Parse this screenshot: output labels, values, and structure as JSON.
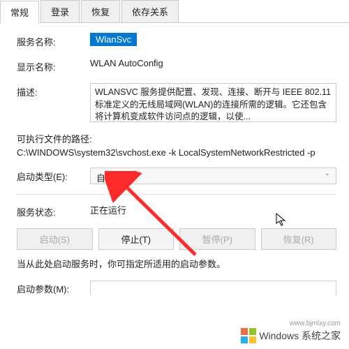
{
  "tabs": [
    "常规",
    "登录",
    "恢复",
    "依存关系"
  ],
  "activeTab": 0,
  "fields": {
    "serviceNameLabel": "服务名称:",
    "serviceName": "WlanSvc",
    "displayNameLabel": "显示名称:",
    "displayName": "WLAN AutoConfig",
    "descLabel": "描述:",
    "description": "WLANSVC 服务提供配置、发现、连接、断开与 IEEE 802.11 标准定义的无线局域网(WLAN)的连接所需的逻辑。它还包含将计算机变成软件访问点的逻辑，以使...",
    "exePathLabel": "可执行文件的路径:",
    "exePath": "C:\\WINDOWS\\system32\\svchost.exe -k LocalSystemNetworkRestricted -p",
    "startupTypeLabel": "启动类型(E):",
    "startupType": "自动",
    "statusLabel": "服务状态:",
    "status": "正在运行",
    "hint": "当从此处启动服务时，你可指定所适用的启动参数。",
    "paramLabel": "启动参数(M):"
  },
  "buttons": {
    "start": "启动(S)",
    "stop": "停止(T)",
    "pause": "暂停(P)",
    "resume": "恢复(R)"
  },
  "watermark": {
    "url": "www.bjmlxy.com",
    "text": "Windows 系统之家"
  },
  "icons": {
    "winLogo": "windows-logo"
  }
}
